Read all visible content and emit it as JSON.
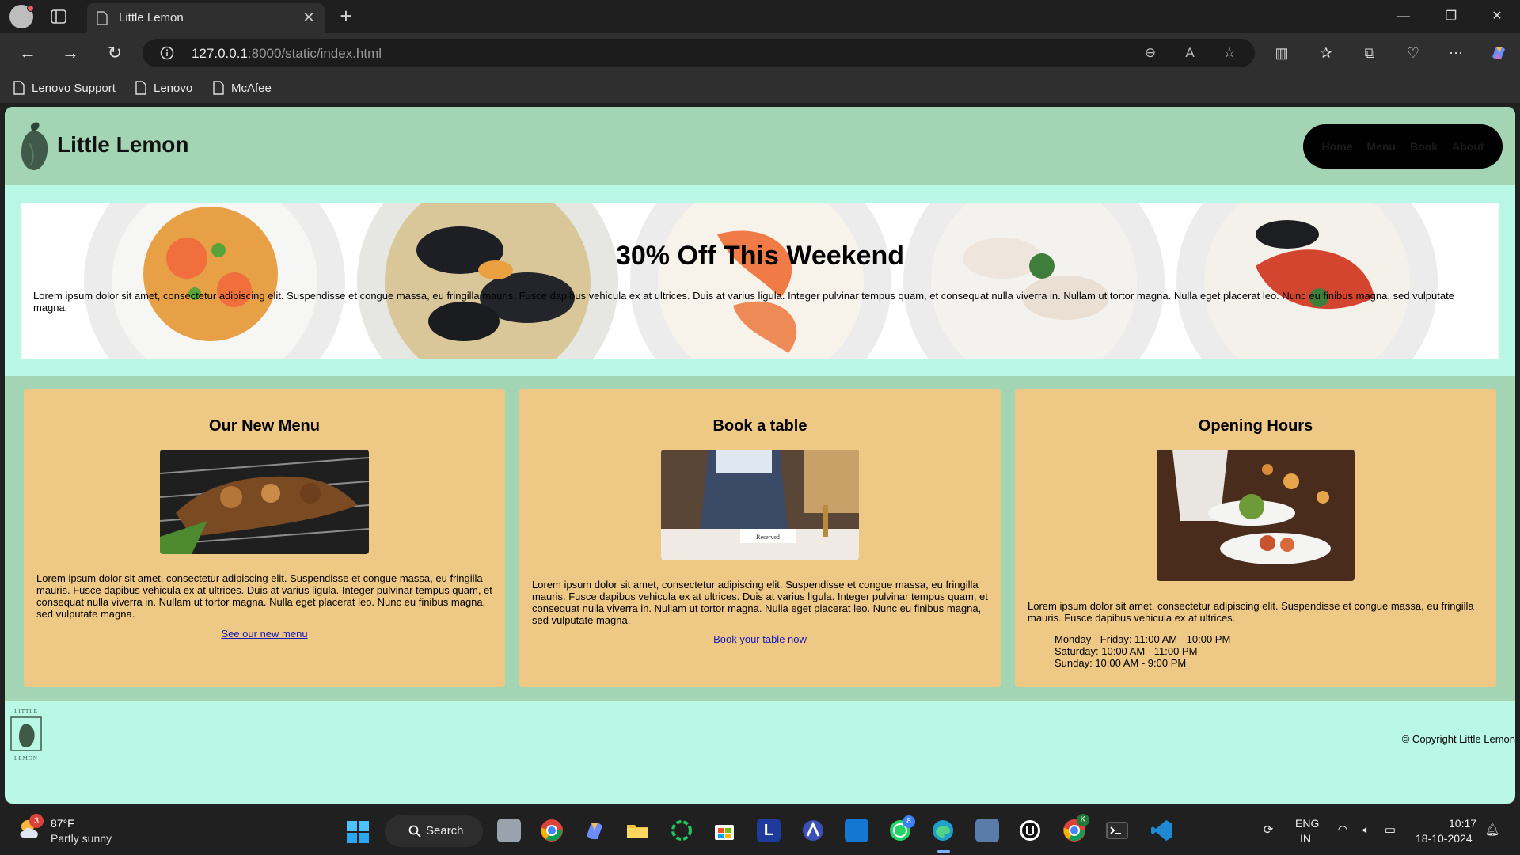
{
  "browser": {
    "tab_title": "Little Lemon",
    "url_host": "127.0.0.1",
    "url_path": ":8000/static/index.html",
    "bookmarks": [
      "Lenovo Support",
      "Lenovo",
      "McAfee"
    ]
  },
  "site": {
    "title": "Little Lemon",
    "nav": [
      "Home",
      "Menu",
      "Book",
      "About"
    ],
    "hero": {
      "title": "30% Off This Weekend",
      "text": "Lorem ipsum dolor sit amet, consectetur adipiscing elit. Suspendisse et congue massa, eu fringilla mauris. Fusce dapibus vehicula ex at ultrices. Duis at varius ligula. Integer pulvinar tempus quam, et consequat nulla viverra in. Nullam ut tortor magna. Nulla eget placerat leo. Nunc eu finibus magna, sed vulputate magna."
    },
    "cards": [
      {
        "title": "Our New Menu",
        "text": "Lorem ipsum dolor sit amet, consectetur adipiscing elit. Suspendisse et congue massa, eu fringilla mauris. Fusce dapibus vehicula ex at ultrices. Duis at varius ligula. Integer pulvinar tempus quam, et consequat nulla viverra in. Nullam ut tortor magna. Nulla eget placerat leo. Nunc eu finibus magna, sed vulputate magna.",
        "link": "See our new menu"
      },
      {
        "title": "Book a table",
        "text": "Lorem ipsum dolor sit amet, consectetur adipiscing elit. Suspendisse et congue massa, eu fringilla mauris. Fusce dapibus vehicula ex at ultrices. Duis at varius ligula. Integer pulvinar tempus quam, et consequat nulla viverra in. Nullam ut tortor magna. Nulla eget placerat leo. Nunc eu finibus magna, sed vulputate magna.",
        "link": "Book your table now",
        "image_caption": "Reserved"
      },
      {
        "title": "Opening Hours",
        "text": "Lorem ipsum dolor sit amet, consectetur adipiscing elit. Suspendisse et congue massa, eu fringilla mauris. Fusce dapibus vehicula ex at ultrices.",
        "hours": [
          "Monday - Friday: 11:00 AM - 10:00 PM",
          "Saturday: 10:00 AM - 11:00 PM",
          "Sunday: 10:00 AM - 9:00 PM"
        ]
      }
    ],
    "footer": {
      "logo_top": "LITTLE",
      "logo_bottom": "LEMON",
      "copyright": "© Copyright Little Lemon"
    }
  },
  "taskbar": {
    "weather_temp": "87°F",
    "weather_desc": "Partly sunny",
    "weather_badge": "3",
    "search_label": "Search",
    "whatsapp_badge": "8",
    "chrome_badge": "K",
    "lang_top": "ENG",
    "lang_bottom": "IN",
    "time": "10:17",
    "date": "18-10-2024"
  },
  "colors": {
    "header_bg": "#a3d4b4",
    "page_bg": "#baf8e6",
    "card_bg": "#eec885",
    "nav_bg": "#000000"
  }
}
